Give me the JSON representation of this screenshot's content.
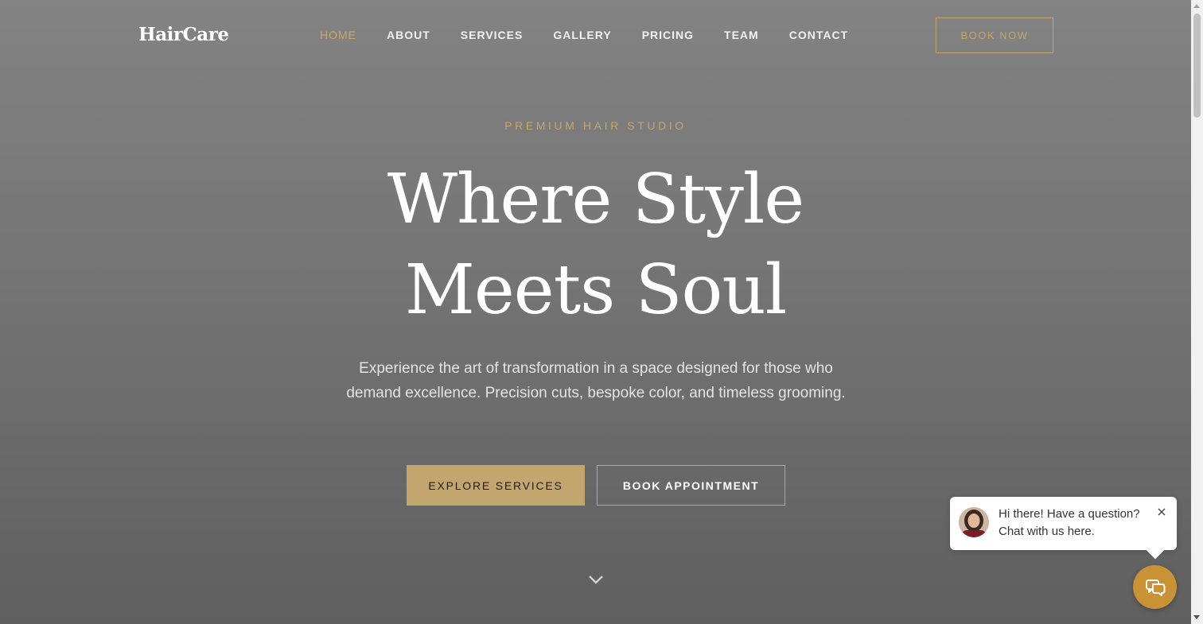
{
  "header": {
    "logo": "HairCare",
    "nav": [
      {
        "label": "HOME",
        "active": true
      },
      {
        "label": "ABOUT",
        "active": false
      },
      {
        "label": "SERVICES",
        "active": false
      },
      {
        "label": "GALLERY",
        "active": false
      },
      {
        "label": "PRICING",
        "active": false
      },
      {
        "label": "TEAM",
        "active": false
      },
      {
        "label": "CONTACT",
        "active": false
      }
    ],
    "book_now_label": "BOOK NOW"
  },
  "hero": {
    "eyebrow": "PREMIUM HAIR STUDIO",
    "title_line1": "Where Style",
    "title_line2": "Meets Soul",
    "description": "Experience the art of transformation in a space designed for those who demand excellence. Precision cuts, bespoke color, and timeless grooming.",
    "primary_button": "EXPLORE SERVICES",
    "secondary_button": "BOOK APPOINTMENT",
    "scroll_icon": "chevron-down-icon"
  },
  "chat": {
    "message_line1": "Hi there! Have a question?",
    "message_line2": "Chat with us here.",
    "close_icon": "close-icon",
    "launcher_icon": "chat-bubbles-icon"
  },
  "colors": {
    "accent_gold": "#c3a66e",
    "chat_orange": "#c89235",
    "hero_bg_top": "#838383",
    "hero_bg_bottom": "#5f5f5f"
  }
}
